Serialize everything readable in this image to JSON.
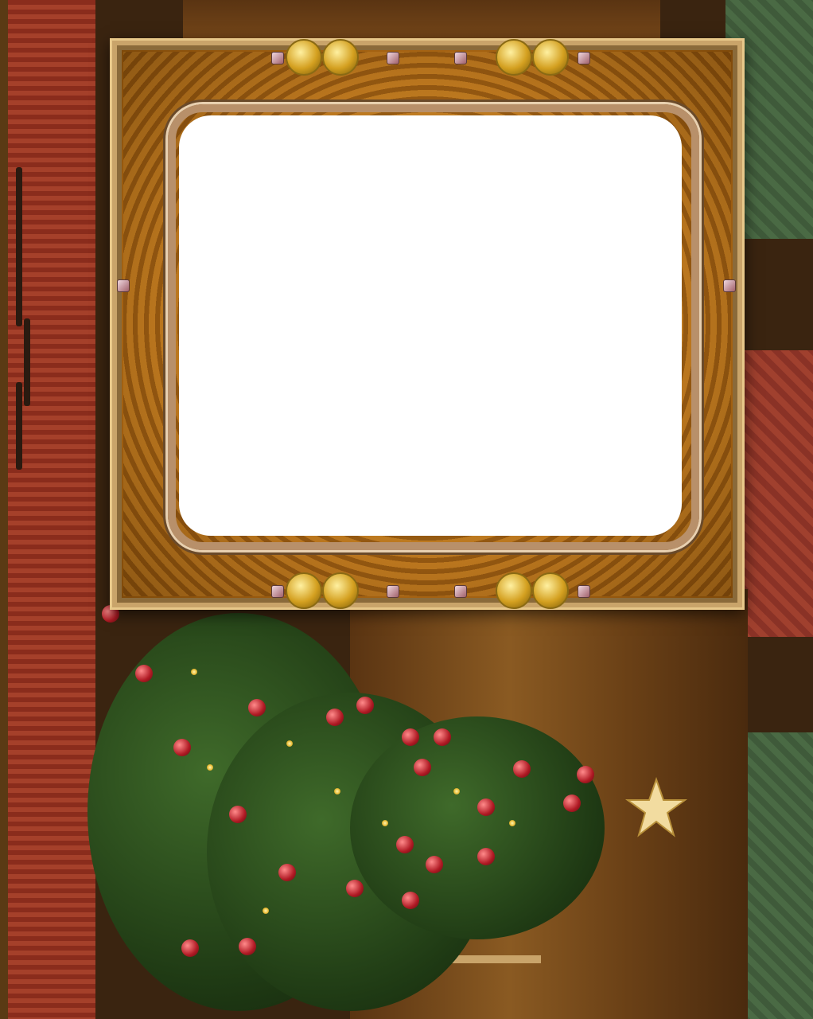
{
  "scene": {
    "description_colors": {
      "frame_gold": "#d89a30",
      "photo_area": "#ffffff",
      "tree_green": "#1f3a14",
      "ornament_red": "#b01a24",
      "carpet_red": "#a5402a",
      "wall_green": "#4a6a44"
    }
  },
  "icons": {
    "frame": "ornate-gold-frame",
    "tree": "christmas-tree-icon",
    "star": "star-icon"
  }
}
